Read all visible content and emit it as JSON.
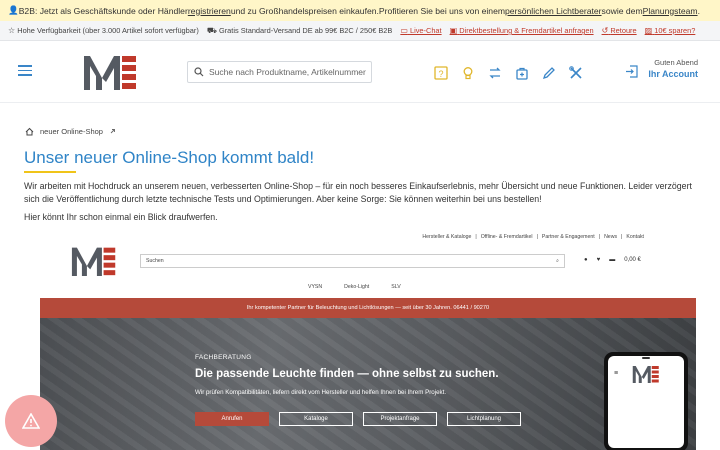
{
  "topbar": {
    "p1": "B2B: Jetzt als Geschäftskunde oder Händler ",
    "link1": "registrieren",
    "p2": " und zu Großhandelspreisen einkaufen.Profitieren Sie bei uns von einem ",
    "link2": "persönlichen Lichtberater",
    "p3": " sowie dem ",
    "link3": "Planungsteam",
    "p4": "."
  },
  "infobar": {
    "availability": "Hohe Verfügbarkeit (über 3.000 Artikel sofort verfügbar)",
    "shipping": "Gratis Standard-Versand DE ab 99€ B2C / 250€ B2B",
    "livechat": "Live-Chat",
    "direct": "Direktbestellung & Fremdartikel anfragen",
    "returns": "Retoure",
    "save": "10€ sparen?"
  },
  "header": {
    "search_placeholder": "Suche nach Produktname, Artikelnummer",
    "greeting": "Guten Abend",
    "account": "Ihr Account"
  },
  "breadcrumb": {
    "current": "neuer Online-Shop"
  },
  "main": {
    "title": "Unser neuer Online-Shop kommt bald!",
    "paragraph": "Wir arbeiten mit Hochdruck an unserem neuen, verbesserten Online-Shop – für ein noch besseres Einkaufserlebnis, mehr Übersicht und neue Funktionen. Leider verzögert sich die Veröffentlichung durch letzte technische Tests und Optimierungen. Aber keine Sorge: Sie können weiterhin bei uns bestellen!",
    "paragraph2": "Hier könnt Ihr schon einmal ein Blick draufwerfen."
  },
  "preview": {
    "nav": [
      "Hersteller & Kataloge",
      "Offline- & Fremdartikel",
      "Partner & Engagement",
      "News",
      "Kontakt"
    ],
    "search": "Suchen",
    "cart": "0,00 €",
    "menu": [
      "VYSN",
      "Deko-Light",
      "SLV"
    ],
    "redbar": "Ihr kompetenter Partner für Beleuchtung und Lichtlösungen — seit über 30 Jahren. 06441 / 90270",
    "eyebrow": "FACHBERATUNG",
    "headline": "Die passende Leuchte finden — ohne selbst zu suchen.",
    "subline": "Wir prüfen Kompatibilitäten, liefern direkt vom Hersteller und helfen Ihnen bei Ihrem Projekt.",
    "buttons": [
      "Anrufen",
      "Kataloge",
      "Projektanfrage",
      "Lichtplanung"
    ]
  },
  "colors": {
    "accent": "#2f84c7",
    "brand_red": "#b54a3a",
    "highlight": "#f0c419"
  }
}
